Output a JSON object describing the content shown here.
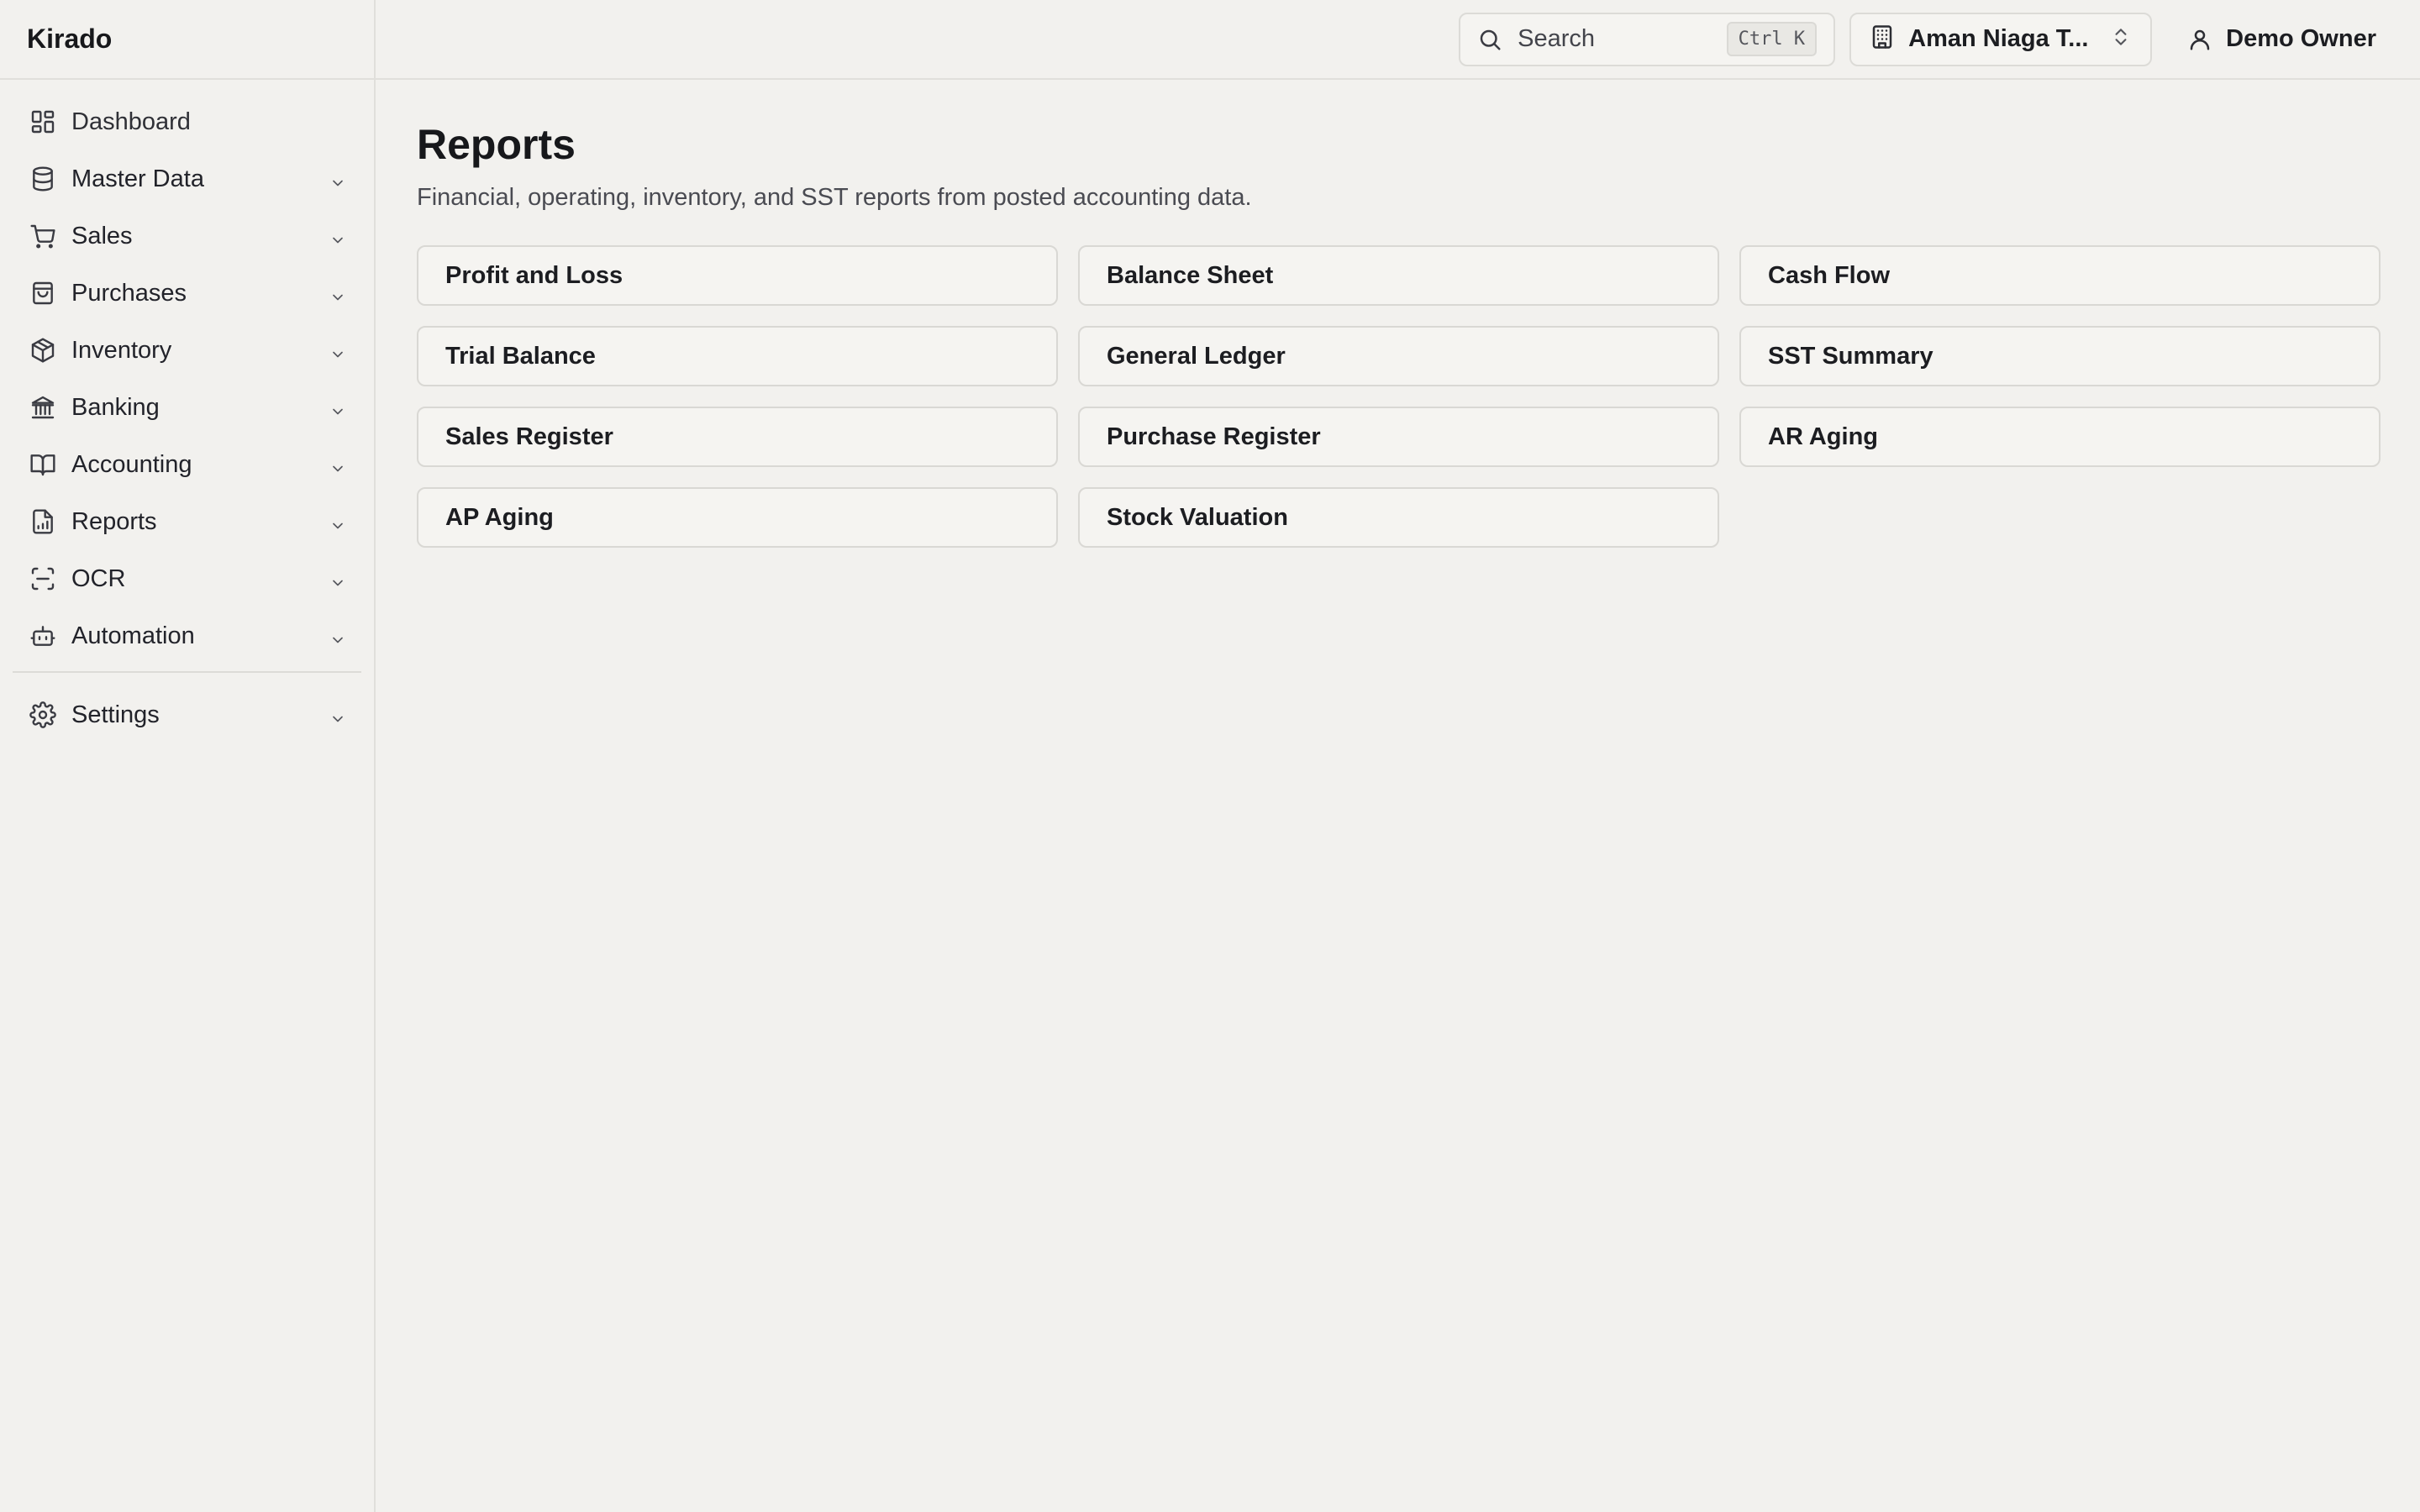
{
  "app": {
    "brand": "Kirado"
  },
  "sidebar": {
    "items": [
      {
        "label": "Dashboard",
        "icon": "dashboard-icon",
        "expandable": false
      },
      {
        "label": "Master Data",
        "icon": "database-icon",
        "expandable": true
      },
      {
        "label": "Sales",
        "icon": "cart-icon",
        "expandable": true
      },
      {
        "label": "Purchases",
        "icon": "shopping-bag-icon",
        "expandable": true
      },
      {
        "label": "Inventory",
        "icon": "package-icon",
        "expandable": true
      },
      {
        "label": "Banking",
        "icon": "bank-icon",
        "expandable": true
      },
      {
        "label": "Accounting",
        "icon": "book-icon",
        "expandable": true
      },
      {
        "label": "Reports",
        "icon": "report-file-icon",
        "expandable": true
      },
      {
        "label": "OCR",
        "icon": "scan-icon",
        "expandable": true
      },
      {
        "label": "Automation",
        "icon": "bot-icon",
        "expandable": true
      }
    ],
    "footer_items": [
      {
        "label": "Settings",
        "icon": "gear-icon",
        "expandable": true
      }
    ]
  },
  "topbar": {
    "search": {
      "placeholder": "Search",
      "shortcut": "Ctrl K"
    },
    "company": {
      "name": "Aman Niaga T..."
    },
    "user": {
      "name": "Demo Owner"
    }
  },
  "main": {
    "title": "Reports",
    "subtitle": "Financial, operating, inventory, and SST reports from posted accounting data.",
    "reports": [
      "Profit and Loss",
      "Balance Sheet",
      "Cash Flow",
      "Trial Balance",
      "General Ledger",
      "SST Summary",
      "Sales Register",
      "Purchase Register",
      "AR Aging",
      "AP Aging",
      "Stock Valuation"
    ]
  },
  "colors": {
    "background": "#f2f1ee",
    "border": "#e0dfdb",
    "text": "#1c1d21",
    "muted": "#4a4b52"
  }
}
